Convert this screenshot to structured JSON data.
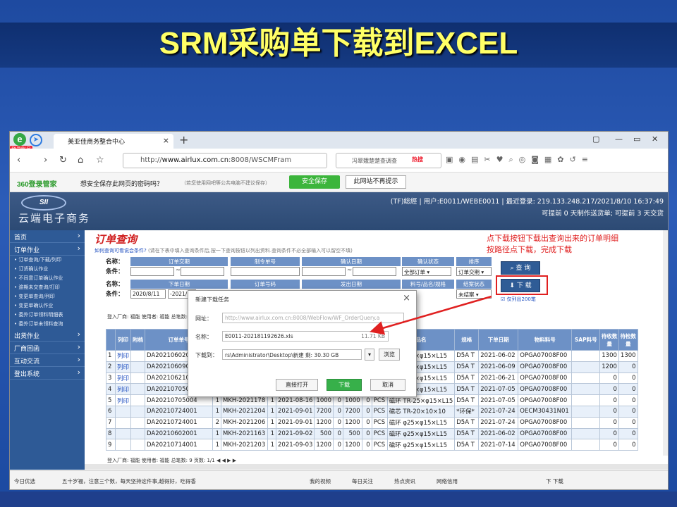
{
  "slide": {
    "title": "SRM采购单下载到EXCEL"
  },
  "browser": {
    "badge": "登录账号",
    "tab_title": "美亚佳商务整合中心",
    "tab_close": "×",
    "new_tab": "+",
    "address_prefix": "http://",
    "address_host": "www.airlux.com.cn",
    "address_rest": ":8008/WSCMFram",
    "search_placeholder": "冯翠娥楚楚查调查",
    "hot_label": "热搜",
    "window_controls": [
      "▢",
      "—",
      "▭",
      "✕"
    ]
  },
  "savebar": {
    "brand": "360登录管家",
    "question": "想安全保存此网页的密码吗？",
    "note": "（若您使用网吧等公共电脑不建议保存）",
    "save_button": "安全保存",
    "no_prompt_button": "此网站不再提示"
  },
  "header": {
    "logo": "SII",
    "brand": "云端电子商务",
    "user_line": "(TF)総經 | 用户:E0011/WEBE0011 | 最近登录: 219.133.248.217/2021/8/10 16:37:49",
    "status_line": "可提前 0 天制作送货单; 可提前 3 天交货"
  },
  "sidebar": {
    "menu": [
      {
        "label": "首页",
        "subs": []
      },
      {
        "label": "订单作业",
        "subs": [
          "订单查询/下载/列印",
          "订货确认作业",
          "不同意订单确认作业",
          "逾期未交查询/打印",
          "变更单查询/列印",
          "变更单确认作业",
          "委外订单领料明细表",
          "委外订单未领料查询"
        ]
      },
      {
        "label": "出货作业",
        "subs": []
      },
      {
        "label": "厂商回函",
        "subs": []
      },
      {
        "label": "互动交流",
        "subs": []
      },
      {
        "label": "登出系统",
        "subs": []
      }
    ]
  },
  "main": {
    "title": "订单查询",
    "tip": "如何查询可看说会条件?",
    "tip_note": "(请在下表中填入查询条件后,按一下查询按钮以列出资料.查询条件不必全部输入可以留空不填)",
    "annotation_line1": "点下载按钮下载出查询出来的订单明细",
    "annotation_line2": "按路径点下载，完成下载",
    "row1_labels": [
      "名称：",
      "条件："
    ],
    "row2_labels": [
      "名称：",
      "条件："
    ],
    "headers_r1": [
      "订单交期",
      "制令单号",
      "确认日期",
      "确认状态",
      "排序"
    ],
    "headers_r2": [
      "下单日期",
      "订单号码",
      "发出日期",
      "料号/品名/规格",
      "结案状态"
    ],
    "tilde": "~",
    "date_from": "2020/8/11",
    "date_to": "-2021/",
    "sel_confirm": "全部订单 ▾",
    "sel_sort": "订单交期 ▾",
    "sel_close": "未结案 ▾",
    "btn_query": "查 询",
    "btn_download": "下 载",
    "chk_label": "☑ 仅列出200笔",
    "totals": "登入厂商: 福能  使用者: 福能  总笔数: 9"
  },
  "table": {
    "columns": [
      "列印",
      "附档",
      "订单单号",
      "",
      "",
      "",
      "",
      "",
      "",
      "",
      "品名",
      "规格",
      "下单日期",
      "物料料号",
      "SAP料号",
      "待收数量",
      "待检数量"
    ],
    "rows": [
      [
        "1",
        "列印",
        "",
        "DA20210602002",
        "",
        "",
        "",
        "",
        "",
        "",
        "",
        "磁环 φ25×φ15×L15",
        "D5A T",
        "2021-06-02",
        "OPGA07008F00",
        "",
        "1300",
        "1300"
      ],
      [
        "2",
        "列印",
        "",
        "DA20210609001",
        "",
        "",
        "",
        "",
        "",
        "",
        "",
        "磁环 φ25×φ15×L15",
        "D5A T",
        "2021-06-09",
        "OPGA07008F00",
        "",
        "1200",
        "0"
      ],
      [
        "3",
        "列印",
        "",
        "DA20210621001",
        "",
        "",
        "",
        "",
        "",
        "",
        "",
        "磁环 φ25×φ15×L15",
        "D5A T",
        "2021-06-21",
        "OPGA07008F00",
        "",
        "0",
        "0"
      ],
      [
        "4",
        "列印",
        "",
        "DA20210705004",
        "",
        "",
        "",
        "",
        "",
        "",
        "",
        "磁环 φ25×φ15×L15",
        "D5A T",
        "2021-07-05",
        "OPGA07008F00",
        "",
        "0",
        "0"
      ],
      [
        "5",
        "列印",
        "",
        "DA20210705004",
        "1",
        "MKH-2021178",
        "1",
        "2021-08-16",
        "1000",
        "0",
        "1000",
        "0",
        "PCS",
        "磁环 TR-25×φ15×L15",
        "D5A T",
        "2021-07-05",
        "OPGA07008F00",
        "0",
        "0"
      ],
      [
        "6",
        "",
        "",
        "DA20210724001",
        "1",
        "MKH-2021204",
        "1",
        "2021-09-01",
        "7200",
        "0",
        "7200",
        "0",
        "PCS",
        "磁芯 TR-20×10×10",
        "*环保*",
        "2021-07-24",
        "OECM30431N01",
        "0",
        "0"
      ],
      [
        "7",
        "",
        "",
        "DA20210724001",
        "2",
        "MKH-2021206",
        "1",
        "2021-09-01",
        "1200",
        "0",
        "1200",
        "0",
        "PCS",
        "磁环 φ25×φ15×L15",
        "D5A T",
        "2021-07-24",
        "OPGA07008F00",
        "0",
        "0"
      ],
      [
        "8",
        "",
        "",
        "DA20210602001",
        "1",
        "MKH-2021163",
        "1",
        "2021-09-02",
        "500",
        "0",
        "500",
        "0",
        "PCS",
        "磁环 φ25×φ15×L15",
        "D5A T",
        "2021-06-02",
        "OPGA07008F00",
        "0",
        "0"
      ],
      [
        "9",
        "",
        "",
        "DA20210714001",
        "1",
        "MKH-2021203",
        "1",
        "2021-09-03",
        "1200",
        "0",
        "1200",
        "0",
        "PCS",
        "磁环 φ25×φ15×L15",
        "D5A T",
        "2021-07-14",
        "OPGA07008F00",
        "0",
        "0"
      ]
    ],
    "pager": "登入厂商: 福能  使用者: 福能  总笔数: 9  页数: 1/1  ◀ ◀ ▶ ▶"
  },
  "dialog": {
    "title": "新建下载任务",
    "close": "×",
    "url_label": "网址：",
    "url_value": "http://www.airlux.com.cn:8008/WebFlow/WF_OrderQuery.a",
    "name_label": "名称：",
    "name_value": "E0011-202181192626.xls",
    "size_value": "11.71 KB",
    "path_label": "下载到：",
    "path_value": "rs\\Administrator\\Desktop\\新建  剩: 30.30 GB",
    "browse": "浏览",
    "open_direct": "直接打开",
    "download": "下载",
    "cancel": "取消"
  },
  "statusbar": {
    "left": "今日优选",
    "news": "五十岁福，注意三个数，每天坚持这件事,越得好，吃得香",
    "items": [
      "我的视频",
      "每日关注",
      "热点资讯",
      "网络信用"
    ],
    "right": "下 下载"
  }
}
